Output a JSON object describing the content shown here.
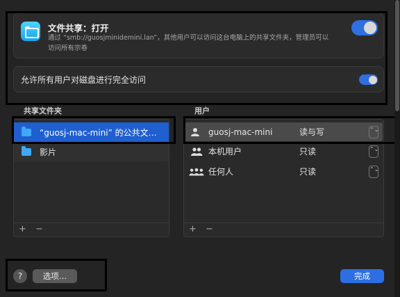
{
  "file_sharing": {
    "title": "文件共享：打开",
    "description": "通过 “smb://guosjminidemini.lan”，其他用户可以访问这台电脑上的共享文件夹，管理员可以访问所有宗卷",
    "enabled": true
  },
  "full_disk": {
    "label": "允许所有用户对磁盘进行完全访问",
    "enabled": true
  },
  "shared_folders": {
    "header": "共享文件夹",
    "items": [
      {
        "label": "“guosj-mac-mini” 的公共文…",
        "selected": true
      },
      {
        "label": "影片",
        "selected": false
      }
    ],
    "add": "+",
    "remove": "−"
  },
  "users": {
    "header": "用户",
    "items": [
      {
        "name": "guosj-mac-mini",
        "permission": "读与写",
        "selected": true,
        "icon": "person-icon"
      },
      {
        "name": "本机用户",
        "permission": "只读",
        "selected": false,
        "icon": "people-icon"
      },
      {
        "name": "任何人",
        "permission": "只读",
        "selected": false,
        "icon": "group-icon"
      }
    ],
    "stepper": "⌃⌄",
    "add": "+",
    "remove": "−"
  },
  "footer": {
    "help": "?",
    "options_label": "选项…",
    "done_label": "完成"
  },
  "colors": {
    "accent": "#2d6fe3",
    "selection": "#1f5fd0"
  }
}
